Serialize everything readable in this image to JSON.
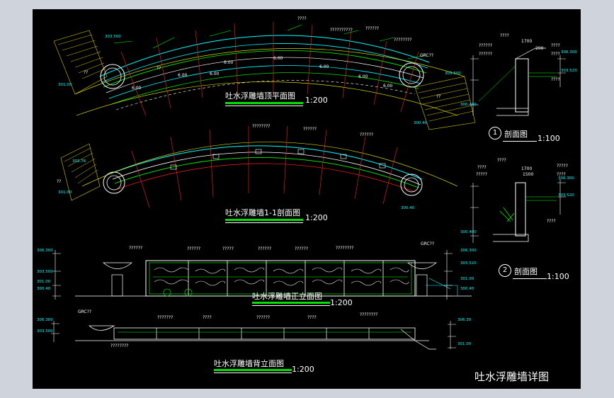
{
  "sheet_title": "吐水浮雕墙详图",
  "views": {
    "roof_plan": {
      "title": "吐水浮雕墙顶平面图",
      "scale": "1:200"
    },
    "section_11": {
      "title": "吐水浮雕墙1-1剖面图",
      "scale": "1:200"
    },
    "front_elev": {
      "title": "吐水浮雕墙正立面图",
      "scale": "1:200"
    },
    "back_elev": {
      "title": "吐水浮雕墙背立面图",
      "scale": "1:200"
    },
    "section_1": {
      "num": "1",
      "title": "剖面图",
      "scale": "1:100"
    },
    "section_2": {
      "num": "2",
      "title": "剖面图",
      "scale": "1:100"
    }
  },
  "annotations": {
    "plan": [
      "??",
      "????",
      "??????????",
      "??????",
      "????????",
      "GRC??",
      "303.500",
      "303.500",
      "301.00",
      "300.40",
      "??",
      "??"
    ],
    "plan_dims": [
      "6.00",
      "6.00",
      "6.00",
      "6.00",
      "6.00",
      "6.00",
      "6.00",
      "6.00"
    ],
    "section": [
      "????????",
      "??????",
      "??????",
      "302.76",
      "??",
      "301.00",
      "300.40"
    ],
    "front": [
      "??????",
      "??????",
      "?????",
      "??????",
      "??????",
      "????????",
      "GRC??",
      "306.300",
      "303.500",
      "301.00",
      "300.40",
      "306.300",
      "303.520",
      "301.00",
      "300.40"
    ],
    "back": [
      "GRC??",
      "306.300",
      "303.500",
      "????????",
      "???????",
      "????",
      "??????",
      "????",
      "????????",
      "306.30",
      "301.00"
    ],
    "detail1": [
      "????",
      "??????",
      "??????",
      "????",
      "????",
      "????",
      "1700",
      "200",
      "306.300",
      "303.520",
      "300.400"
    ],
    "detail2": [
      "????",
      "????",
      "?????",
      "?????",
      "????",
      "????",
      "1700",
      "1500",
      "306.300",
      "303.520",
      "300.400"
    ]
  }
}
